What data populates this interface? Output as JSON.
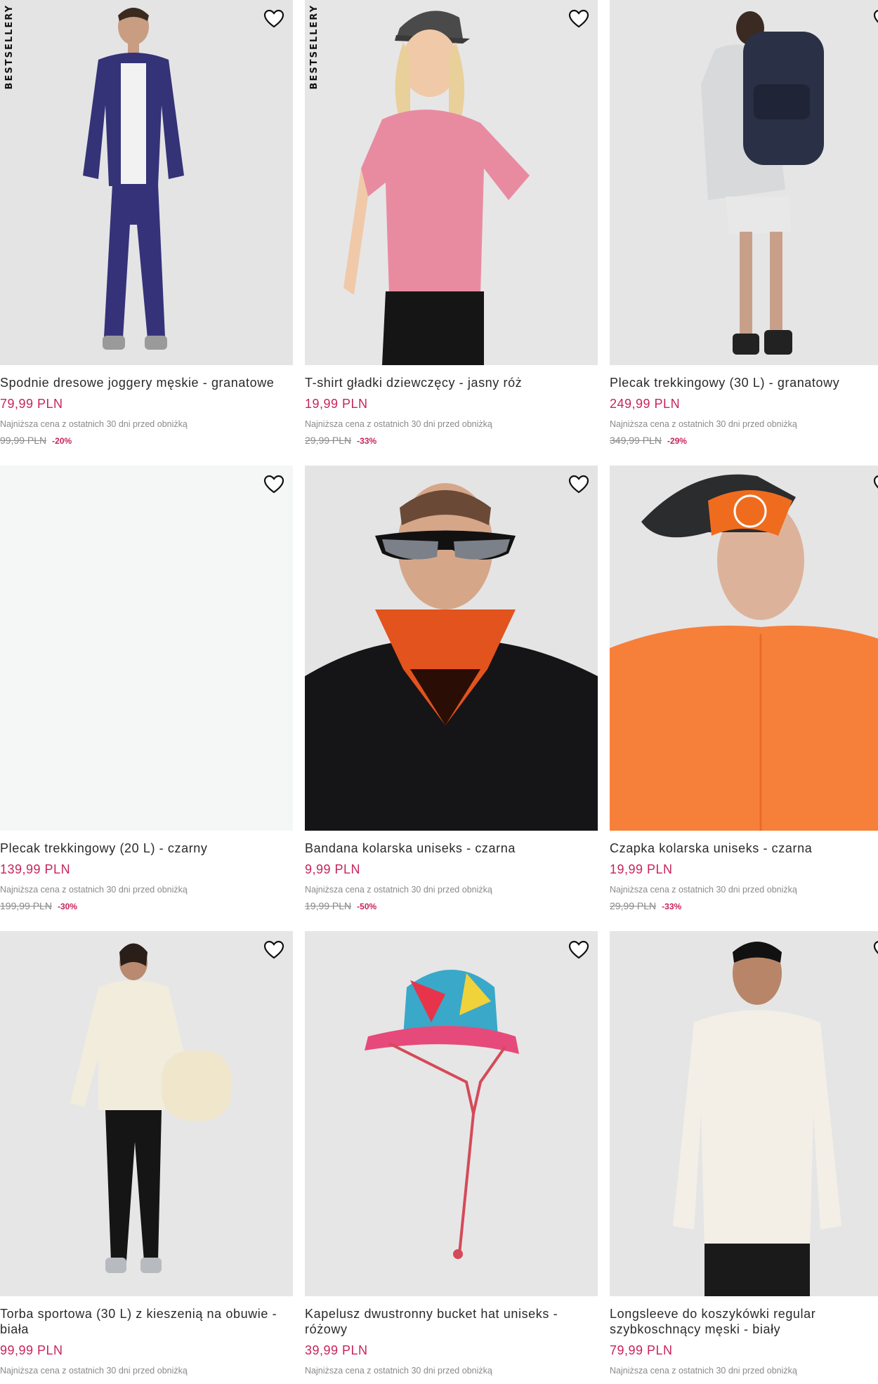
{
  "favorite_icon": "heart-outline-icon",
  "colors": {
    "price": "#c8245a",
    "image_bg": "#e6e6e7",
    "text": "#2a2a2a",
    "muted": "#8a8a8a"
  },
  "products": [
    {
      "badge": "BESTSELLERY",
      "title": "Spodnie dresowe joggery męskie - granatowe",
      "price": "79,99 PLN",
      "note": "Najniższa cena z ostatnich 30 dni przed obniżką",
      "old_price": "99,99 PLN",
      "discount": "-20%"
    },
    {
      "badge": "BESTSELLERY",
      "title": "T-shirt gładki dziewczęcy - jasny róż",
      "price": "19,99 PLN",
      "note": "Najniższa cena z ostatnich 30 dni przed obniżką",
      "old_price": "29,99 PLN",
      "discount": "-33%"
    },
    {
      "badge": "",
      "title": "Plecak trekkingowy (30 L) - granatowy",
      "price": "249,99 PLN",
      "note": "Najniższa cena z ostatnich 30 dni przed obniżką",
      "old_price": "349,99 PLN",
      "discount": "-29%"
    },
    {
      "badge": "",
      "title": "Plecak trekkingowy (20 L) - czarny",
      "price": "139,99 PLN",
      "note": "Najniższa cena z ostatnich 30 dni przed obniżką",
      "old_price": "199,99 PLN",
      "discount": "-30%"
    },
    {
      "badge": "",
      "title": "Bandana kolarska uniseks - czarna",
      "price": "9,99 PLN",
      "note": "Najniższa cena z ostatnich 30 dni przed obniżką",
      "old_price": "19,99 PLN",
      "discount": "-50%"
    },
    {
      "badge": "",
      "title": "Czapka kolarska uniseks - czarna",
      "price": "19,99 PLN",
      "note": "Najniższa cena z ostatnich 30 dni przed obniżką",
      "old_price": "29,99 PLN",
      "discount": "-33%"
    },
    {
      "badge": "",
      "title": "Torba sportowa (30 L) z kieszenią na obuwie - biała",
      "price": "99,99 PLN",
      "note": "Najniższa cena z ostatnich 30 dni przed obniżką",
      "old_price": "",
      "discount": ""
    },
    {
      "badge": "",
      "title": "Kapelusz dwustronny bucket hat uniseks - różowy",
      "price": "39,99 PLN",
      "note": "Najniższa cena z ostatnich 30 dni przed obniżką",
      "old_price": "",
      "discount": ""
    },
    {
      "badge": "",
      "title": "Longsleeve do koszykówki regular szybkoschnący męski - biały",
      "price": "79,99 PLN",
      "note": "Najniższa cena z ostatnich 30 dni przed obniżką",
      "old_price": "",
      "discount": ""
    }
  ]
}
